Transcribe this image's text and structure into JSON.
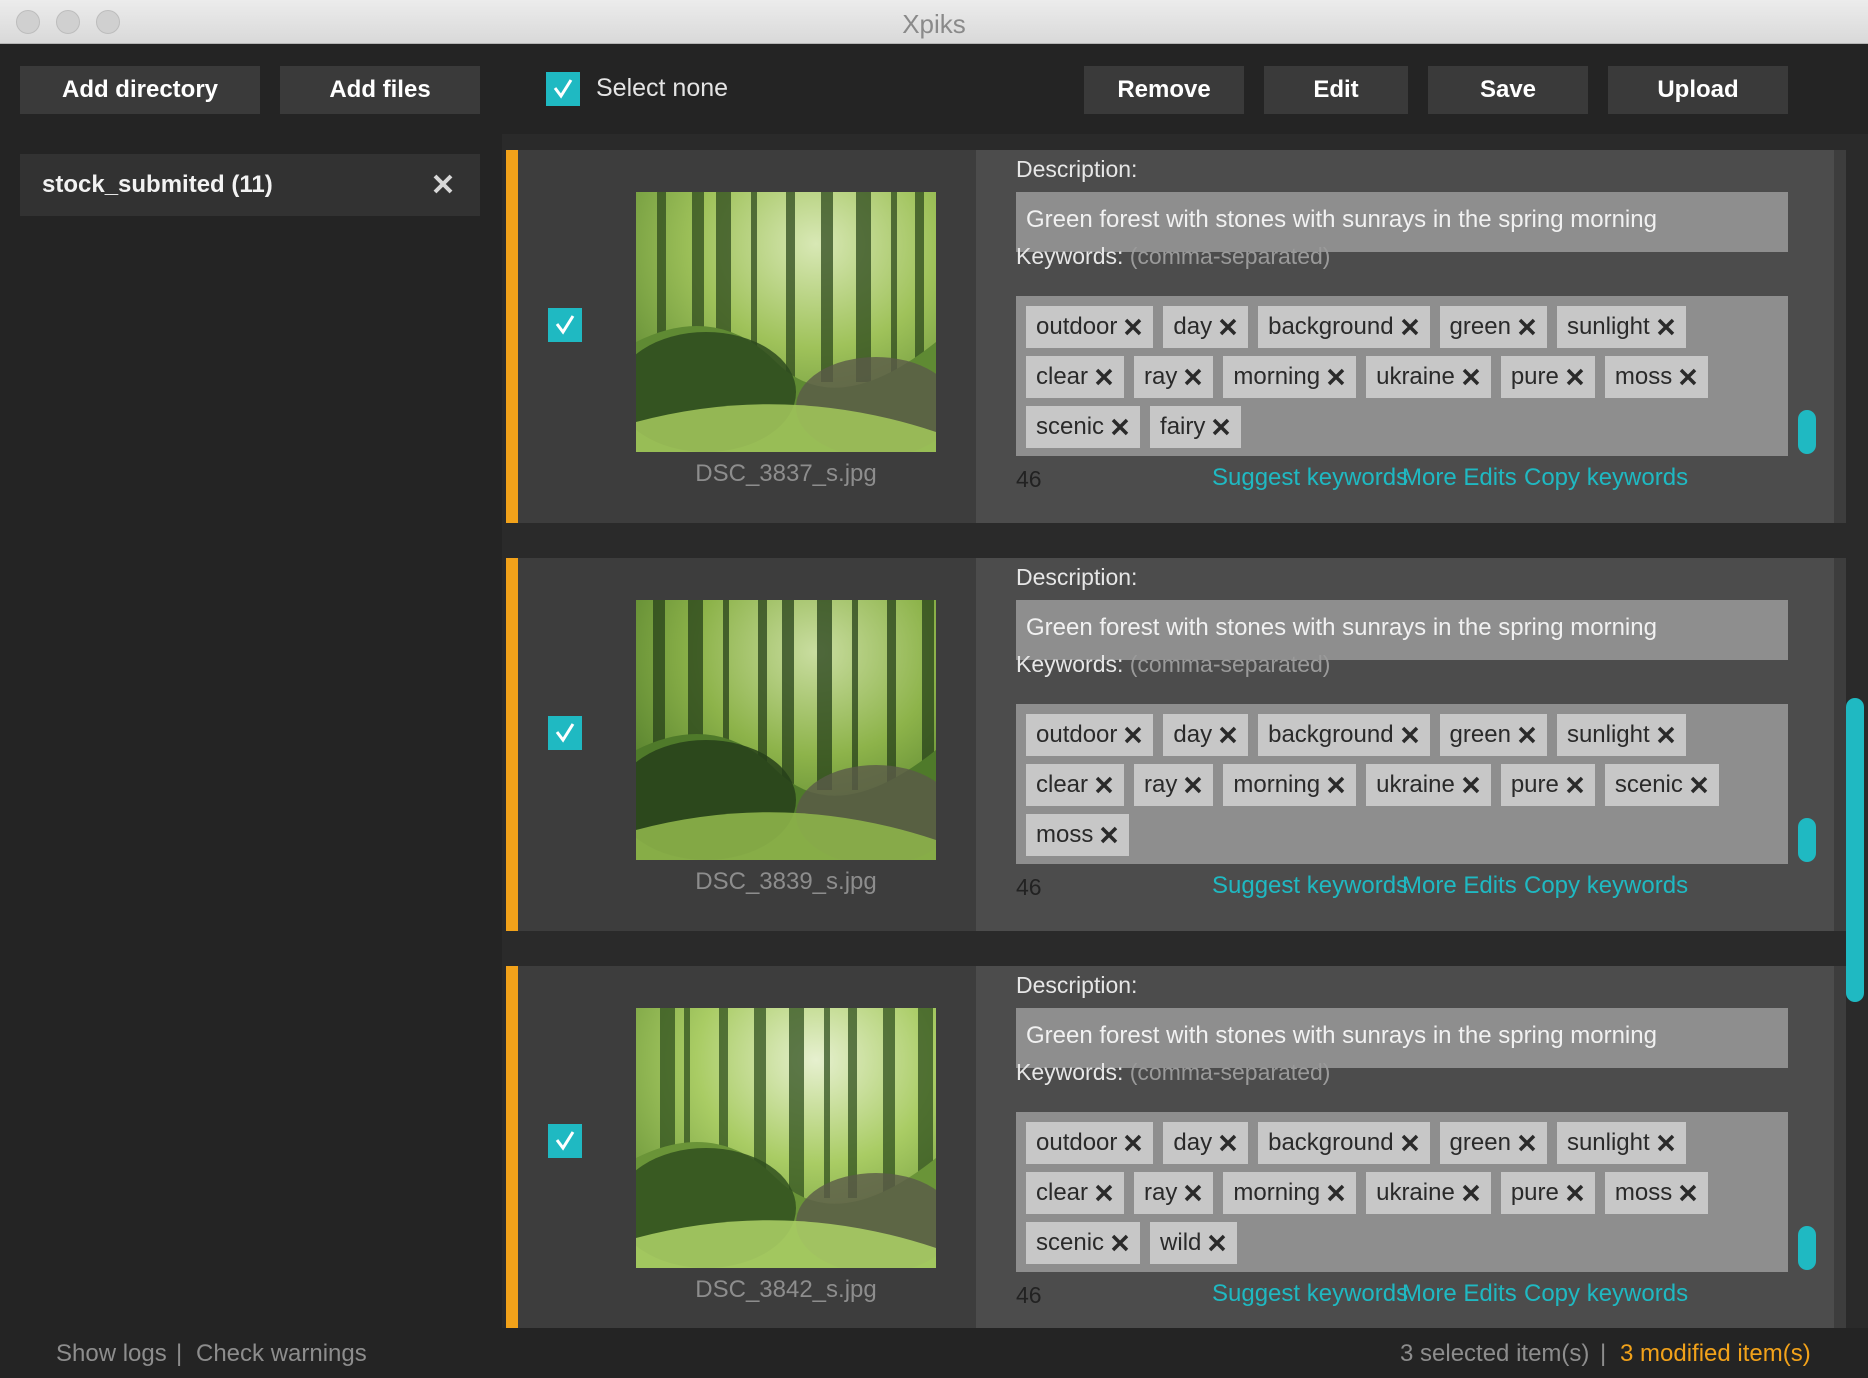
{
  "window": {
    "title": "Xpiks"
  },
  "toolbar": {
    "add_directory": "Add directory",
    "add_files": "Add files",
    "select_none": "Select none",
    "remove": "Remove",
    "edit": "Edit",
    "save": "Save",
    "upload": "Upload"
  },
  "sidebar": {
    "directories": [
      {
        "label": "stock_submited (11)"
      }
    ]
  },
  "colors": {
    "accent": "#1fb9c2",
    "modified": "#f2a21a"
  },
  "items": [
    {
      "filename": "DSC_3837_s.jpg",
      "description_label": "Description:",
      "description": "Green forest with stones with sunrays in the spring morning",
      "keywords_label": "Keywords:",
      "keywords_hint": "(comma-separated)",
      "keywords": [
        "outdoor",
        "day",
        "background",
        "green",
        "sunlight",
        "clear",
        "ray",
        "morning",
        "ukraine",
        "pure",
        "moss",
        "scenic",
        "fairy"
      ],
      "char_count": "46",
      "suggest": "Suggest keywords",
      "more_edits": "More Edits",
      "copy": "Copy keywords"
    },
    {
      "filename": "DSC_3839_s.jpg",
      "description_label": "Description:",
      "description": "Green forest with stones with sunrays in the spring morning",
      "keywords_label": "Keywords:",
      "keywords_hint": "(comma-separated)",
      "keywords": [
        "outdoor",
        "day",
        "background",
        "green",
        "sunlight",
        "clear",
        "ray",
        "morning",
        "ukraine",
        "pure",
        "scenic",
        "moss"
      ],
      "char_count": "46",
      "suggest": "Suggest keywords",
      "more_edits": "More Edits",
      "copy": "Copy keywords"
    },
    {
      "filename": "DSC_3842_s.jpg",
      "description_label": "Description:",
      "description": "Green forest with stones with sunrays in the spring morning",
      "keywords_label": "Keywords:",
      "keywords_hint": "(comma-separated)",
      "keywords": [
        "outdoor",
        "day",
        "background",
        "green",
        "sunlight",
        "clear",
        "ray",
        "morning",
        "ukraine",
        "pure",
        "moss",
        "scenic",
        "wild"
      ],
      "char_count": "46",
      "suggest": "Suggest keywords",
      "more_edits": "More Edits",
      "copy": "Copy keywords"
    }
  ],
  "status": {
    "show_logs": "Show logs",
    "separator": "|",
    "check_warnings": "Check warnings",
    "selected": "3 selected item(s)",
    "modified": "3 modified item(s)"
  }
}
